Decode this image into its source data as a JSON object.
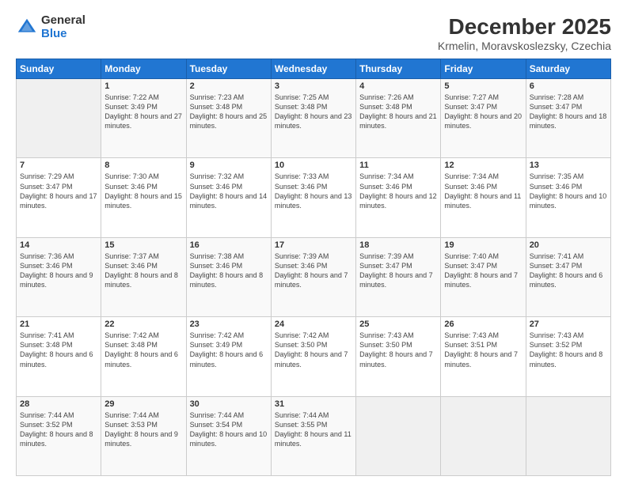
{
  "logo": {
    "general": "General",
    "blue": "Blue"
  },
  "title": "December 2025",
  "subtitle": "Krmelin, Moravskoslezsky, Czechia",
  "days_header": [
    "Sunday",
    "Monday",
    "Tuesday",
    "Wednesday",
    "Thursday",
    "Friday",
    "Saturday"
  ],
  "weeks": [
    [
      {
        "num": "",
        "sunrise": "",
        "sunset": "",
        "daylight": ""
      },
      {
        "num": "1",
        "sunrise": "Sunrise: 7:22 AM",
        "sunset": "Sunset: 3:49 PM",
        "daylight": "Daylight: 8 hours and 27 minutes."
      },
      {
        "num": "2",
        "sunrise": "Sunrise: 7:23 AM",
        "sunset": "Sunset: 3:48 PM",
        "daylight": "Daylight: 8 hours and 25 minutes."
      },
      {
        "num": "3",
        "sunrise": "Sunrise: 7:25 AM",
        "sunset": "Sunset: 3:48 PM",
        "daylight": "Daylight: 8 hours and 23 minutes."
      },
      {
        "num": "4",
        "sunrise": "Sunrise: 7:26 AM",
        "sunset": "Sunset: 3:48 PM",
        "daylight": "Daylight: 8 hours and 21 minutes."
      },
      {
        "num": "5",
        "sunrise": "Sunrise: 7:27 AM",
        "sunset": "Sunset: 3:47 PM",
        "daylight": "Daylight: 8 hours and 20 minutes."
      },
      {
        "num": "6",
        "sunrise": "Sunrise: 7:28 AM",
        "sunset": "Sunset: 3:47 PM",
        "daylight": "Daylight: 8 hours and 18 minutes."
      }
    ],
    [
      {
        "num": "7",
        "sunrise": "Sunrise: 7:29 AM",
        "sunset": "Sunset: 3:47 PM",
        "daylight": "Daylight: 8 hours and 17 minutes."
      },
      {
        "num": "8",
        "sunrise": "Sunrise: 7:30 AM",
        "sunset": "Sunset: 3:46 PM",
        "daylight": "Daylight: 8 hours and 15 minutes."
      },
      {
        "num": "9",
        "sunrise": "Sunrise: 7:32 AM",
        "sunset": "Sunset: 3:46 PM",
        "daylight": "Daylight: 8 hours and 14 minutes."
      },
      {
        "num": "10",
        "sunrise": "Sunrise: 7:33 AM",
        "sunset": "Sunset: 3:46 PM",
        "daylight": "Daylight: 8 hours and 13 minutes."
      },
      {
        "num": "11",
        "sunrise": "Sunrise: 7:34 AM",
        "sunset": "Sunset: 3:46 PM",
        "daylight": "Daylight: 8 hours and 12 minutes."
      },
      {
        "num": "12",
        "sunrise": "Sunrise: 7:34 AM",
        "sunset": "Sunset: 3:46 PM",
        "daylight": "Daylight: 8 hours and 11 minutes."
      },
      {
        "num": "13",
        "sunrise": "Sunrise: 7:35 AM",
        "sunset": "Sunset: 3:46 PM",
        "daylight": "Daylight: 8 hours and 10 minutes."
      }
    ],
    [
      {
        "num": "14",
        "sunrise": "Sunrise: 7:36 AM",
        "sunset": "Sunset: 3:46 PM",
        "daylight": "Daylight: 8 hours and 9 minutes."
      },
      {
        "num": "15",
        "sunrise": "Sunrise: 7:37 AM",
        "sunset": "Sunset: 3:46 PM",
        "daylight": "Daylight: 8 hours and 8 minutes."
      },
      {
        "num": "16",
        "sunrise": "Sunrise: 7:38 AM",
        "sunset": "Sunset: 3:46 PM",
        "daylight": "Daylight: 8 hours and 8 minutes."
      },
      {
        "num": "17",
        "sunrise": "Sunrise: 7:39 AM",
        "sunset": "Sunset: 3:46 PM",
        "daylight": "Daylight: 8 hours and 7 minutes."
      },
      {
        "num": "18",
        "sunrise": "Sunrise: 7:39 AM",
        "sunset": "Sunset: 3:47 PM",
        "daylight": "Daylight: 8 hours and 7 minutes."
      },
      {
        "num": "19",
        "sunrise": "Sunrise: 7:40 AM",
        "sunset": "Sunset: 3:47 PM",
        "daylight": "Daylight: 8 hours and 7 minutes."
      },
      {
        "num": "20",
        "sunrise": "Sunrise: 7:41 AM",
        "sunset": "Sunset: 3:47 PM",
        "daylight": "Daylight: 8 hours and 6 minutes."
      }
    ],
    [
      {
        "num": "21",
        "sunrise": "Sunrise: 7:41 AM",
        "sunset": "Sunset: 3:48 PM",
        "daylight": "Daylight: 8 hours and 6 minutes."
      },
      {
        "num": "22",
        "sunrise": "Sunrise: 7:42 AM",
        "sunset": "Sunset: 3:48 PM",
        "daylight": "Daylight: 8 hours and 6 minutes."
      },
      {
        "num": "23",
        "sunrise": "Sunrise: 7:42 AM",
        "sunset": "Sunset: 3:49 PM",
        "daylight": "Daylight: 8 hours and 6 minutes."
      },
      {
        "num": "24",
        "sunrise": "Sunrise: 7:42 AM",
        "sunset": "Sunset: 3:50 PM",
        "daylight": "Daylight: 8 hours and 7 minutes."
      },
      {
        "num": "25",
        "sunrise": "Sunrise: 7:43 AM",
        "sunset": "Sunset: 3:50 PM",
        "daylight": "Daylight: 8 hours and 7 minutes."
      },
      {
        "num": "26",
        "sunrise": "Sunrise: 7:43 AM",
        "sunset": "Sunset: 3:51 PM",
        "daylight": "Daylight: 8 hours and 7 minutes."
      },
      {
        "num": "27",
        "sunrise": "Sunrise: 7:43 AM",
        "sunset": "Sunset: 3:52 PM",
        "daylight": "Daylight: 8 hours and 8 minutes."
      }
    ],
    [
      {
        "num": "28",
        "sunrise": "Sunrise: 7:44 AM",
        "sunset": "Sunset: 3:52 PM",
        "daylight": "Daylight: 8 hours and 8 minutes."
      },
      {
        "num": "29",
        "sunrise": "Sunrise: 7:44 AM",
        "sunset": "Sunset: 3:53 PM",
        "daylight": "Daylight: 8 hours and 9 minutes."
      },
      {
        "num": "30",
        "sunrise": "Sunrise: 7:44 AM",
        "sunset": "Sunset: 3:54 PM",
        "daylight": "Daylight: 8 hours and 10 minutes."
      },
      {
        "num": "31",
        "sunrise": "Sunrise: 7:44 AM",
        "sunset": "Sunset: 3:55 PM",
        "daylight": "Daylight: 8 hours and 11 minutes."
      },
      {
        "num": "",
        "sunrise": "",
        "sunset": "",
        "daylight": ""
      },
      {
        "num": "",
        "sunrise": "",
        "sunset": "",
        "daylight": ""
      },
      {
        "num": "",
        "sunrise": "",
        "sunset": "",
        "daylight": ""
      }
    ]
  ]
}
